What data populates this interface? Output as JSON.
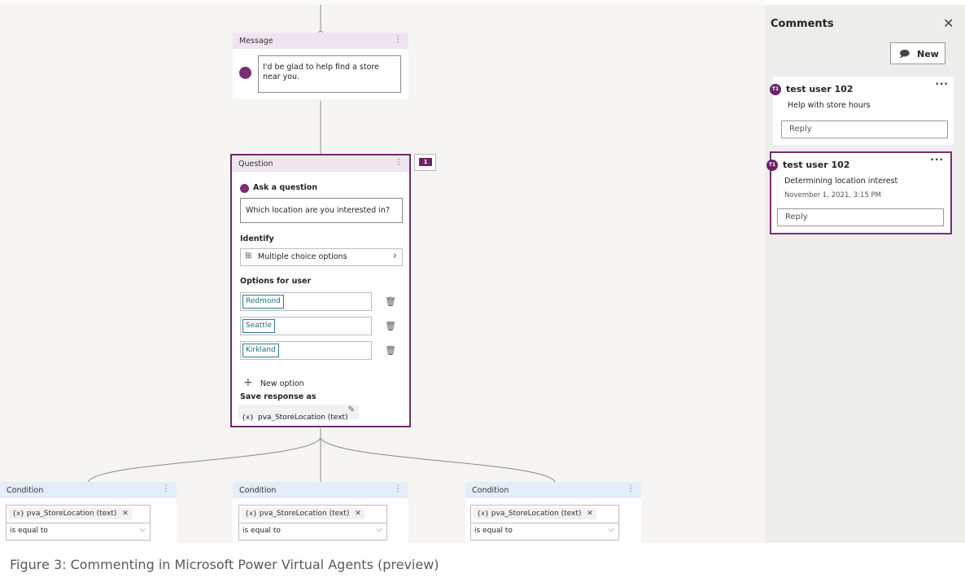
{
  "message_node": {
    "title": "Message",
    "text": "I'd be glad to help find a store near you."
  },
  "question_node": {
    "title": "Question",
    "comment_count": "1",
    "ask_label": "Ask a question",
    "question_text": "Which location are you interested in?",
    "identify_label": "Identify",
    "identify_value": "Multiple choice options",
    "options_label": "Options for user",
    "options": [
      "Redmond",
      "Seattle",
      "Kirkland"
    ],
    "new_option": "New option",
    "save_label": "Save response as",
    "save_var_icon": "{x}",
    "save_var": "pva_StoreLocation (text)"
  },
  "conditions": [
    {
      "title": "Condition",
      "var_icon": "{x}",
      "variable": "pva_StoreLocation (text)",
      "operator": "is equal to"
    },
    {
      "title": "Condition",
      "var_icon": "{x}",
      "variable": "pva_StoreLocation (text)",
      "operator": "is equal to"
    },
    {
      "title": "Condition",
      "var_icon": "{x}",
      "variable": "pva_StoreLocation (text)",
      "operator": "is equal to"
    }
  ],
  "comments_panel": {
    "title": "Comments",
    "new_label": "New",
    "threads": [
      {
        "initials": "T1",
        "author": "test user 102",
        "text": "Help with store hours",
        "date": "",
        "reply_placeholder": "Reply"
      },
      {
        "initials": "T1",
        "author": "test user 102",
        "text": "Determining location interest",
        "date": "November 1, 2021, 3:15 PM",
        "reply_placeholder": "Reply"
      }
    ]
  },
  "caption": "Figure 3: Commenting in Microsoft Power Virtual Agents (preview)",
  "colors": {
    "accent": "#7a2d73",
    "canvas": "#f6f5f3",
    "panel": "#ededec"
  }
}
